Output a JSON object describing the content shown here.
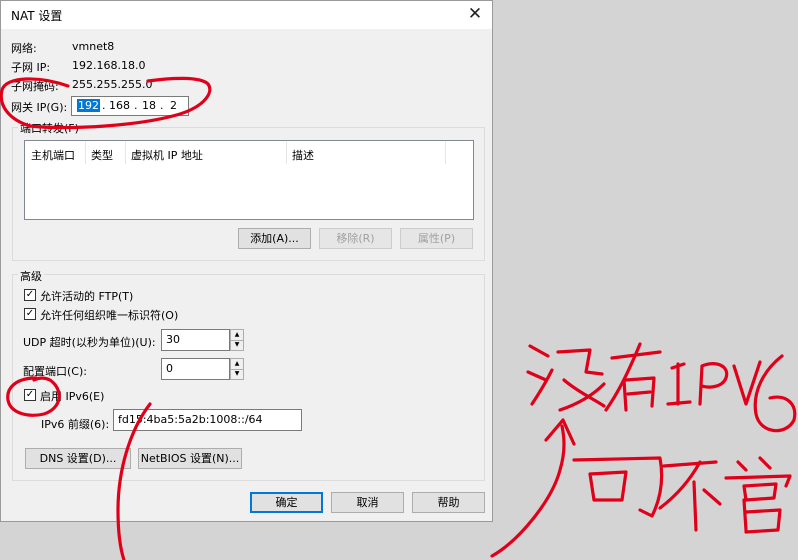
{
  "dialog": {
    "title": "NAT 设置",
    "network_label": "网络:",
    "network_value": "vmnet8",
    "subnet_ip_label": "子网 IP:",
    "subnet_ip_value": "192.168.18.0",
    "subnet_mask_label": "子网掩码:",
    "subnet_mask_value": "255.255.255.0",
    "gateway_label": "网关 IP(G):",
    "gateway_octets": [
      "192",
      "168",
      "18",
      "2"
    ]
  },
  "port_forwarding": {
    "title": "端口转发(F)",
    "columns": [
      "主机端口",
      "类型",
      "虚拟机 IP 地址",
      "描述"
    ],
    "add_label": "添加(A)...",
    "remove_label": "移除(R)",
    "properties_label": "属性(P)"
  },
  "advanced": {
    "title": "高级",
    "allow_ftp_label": "允许活动的 FTP(T)",
    "allow_ftp_checked": true,
    "allow_oui_label": "允许任何组织唯一标识符(O)",
    "allow_oui_checked": true,
    "udp_timeout_label": "UDP 超时(以秒为单位)(U):",
    "udp_timeout_value": "30",
    "config_port_label": "配置端口(C):",
    "config_port_value": "0",
    "enable_ipv6_label": "启用 IPv6(E)",
    "enable_ipv6_checked": true,
    "ipv6_prefix_label": "IPv6 前缀(6):",
    "ipv6_prefix_value": "fd15:4ba5:5a2b:1008::/64",
    "dns_label": "DNS 设置(D)...",
    "netbios_label": "NetBIOS 设置(N)..."
  },
  "footer": {
    "ok_label": "确定",
    "cancel_label": "取消",
    "help_label": "帮助"
  },
  "annotation": {
    "ink_color": "#e0001a"
  }
}
